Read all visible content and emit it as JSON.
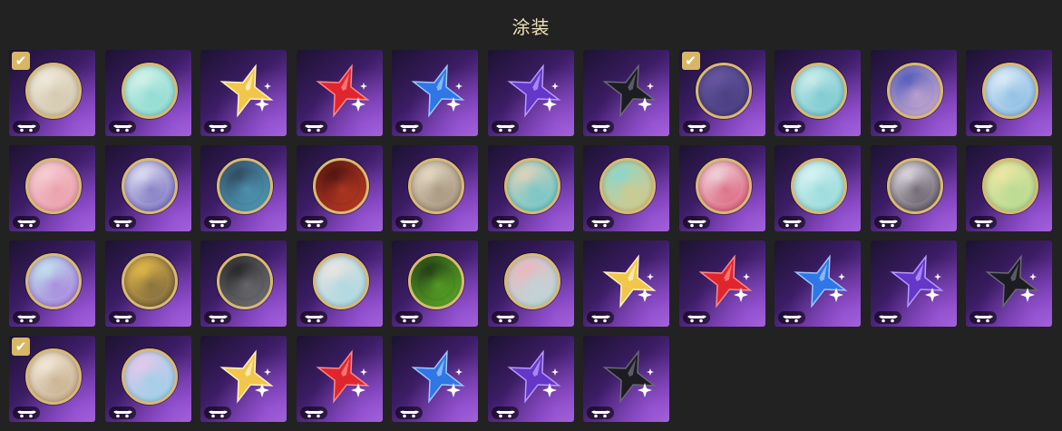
{
  "page": {
    "title": "涂装"
  },
  "tiles": [
    {
      "kind": "disc",
      "colors": [
        "#f4efe2",
        "#c7b89a"
      ],
      "selected": true,
      "icon": "white-creature-icon"
    },
    {
      "kind": "disc",
      "colors": [
        "#dff6ee",
        "#6fd0c6"
      ],
      "selected": false,
      "icon": "teal-wave-icon"
    },
    {
      "kind": "star",
      "colors": [
        "#f2c64a",
        "#fff3c4"
      ],
      "selected": false,
      "icon": "gold-star-icon"
    },
    {
      "kind": "star",
      "colors": [
        "#e0262c",
        "#ff8a8a"
      ],
      "selected": false,
      "icon": "red-star-icon"
    },
    {
      "kind": "star",
      "colors": [
        "#2f76e6",
        "#9cc7ff"
      ],
      "selected": false,
      "icon": "blue-star-icon"
    },
    {
      "kind": "star",
      "colors": [
        "#6437c8",
        "#b79bff"
      ],
      "selected": false,
      "icon": "purple-star-icon"
    },
    {
      "kind": "star",
      "colors": [
        "#1c1c22",
        "#6a6a78"
      ],
      "selected": false,
      "icon": "black-star-icon"
    },
    {
      "kind": "disc",
      "colors": [
        "#6a5aa6",
        "#3f3572"
      ],
      "selected": true,
      "icon": "emblem-icon"
    },
    {
      "kind": "disc",
      "colors": [
        "#d9f3f1",
        "#56b9c3"
      ],
      "selected": false,
      "icon": "cyan-beast-icon"
    },
    {
      "kind": "disc",
      "colors": [
        "#3f4fb8",
        "#f3c7d6"
      ],
      "selected": false,
      "icon": "pink-girl-icon"
    },
    {
      "kind": "disc",
      "colors": [
        "#e8f3fb",
        "#6ea9d9"
      ],
      "selected": false,
      "icon": "wave-pattern-icon"
    },
    {
      "kind": "disc",
      "colors": [
        "#f7d5da",
        "#e58b99"
      ],
      "selected": false,
      "icon": "pink-character-icon"
    },
    {
      "kind": "disc",
      "colors": [
        "#eef0fa",
        "#5b4fb0"
      ],
      "selected": false,
      "icon": "winged-crest-icon"
    },
    {
      "kind": "disc",
      "colors": [
        "#2a3d52",
        "#5db8d9"
      ],
      "selected": false,
      "icon": "blue-tree-icon"
    },
    {
      "kind": "disc",
      "colors": [
        "#3b0e0e",
        "#e4472a"
      ],
      "selected": false,
      "icon": "flame-icon"
    },
    {
      "kind": "disc",
      "colors": [
        "#efe4cf",
        "#8a7760"
      ],
      "selected": false,
      "icon": "moon-icon"
    },
    {
      "kind": "disc",
      "colors": [
        "#f4d5b4",
        "#3fc1d0"
      ],
      "selected": false,
      "icon": "orange-mask-icon"
    },
    {
      "kind": "disc",
      "colors": [
        "#7fd8d7",
        "#f1c56f"
      ],
      "selected": false,
      "icon": "blonde-character-icon"
    },
    {
      "kind": "disc",
      "colors": [
        "#f2e8ec",
        "#d43b5c"
      ],
      "selected": false,
      "icon": "dragon-swoosh-icon"
    },
    {
      "kind": "disc",
      "colors": [
        "#e3f7f6",
        "#7dcfd0"
      ],
      "selected": false,
      "icon": "crystal-spirit-icon"
    },
    {
      "kind": "disc",
      "colors": [
        "#f0eef2",
        "#3a2e3c"
      ],
      "selected": false,
      "icon": "eye-orb-icon"
    },
    {
      "kind": "disc",
      "colors": [
        "#f6e9a6",
        "#9fd48a"
      ],
      "selected": false,
      "icon": "green-girl-icon"
    },
    {
      "kind": "disc",
      "colors": [
        "#c6f1ee",
        "#9a62d6"
      ],
      "selected": false,
      "icon": "gem-eye-icon"
    },
    {
      "kind": "disc",
      "colors": [
        "#f2c64a",
        "#5a4a3a"
      ],
      "selected": false,
      "icon": "robot-pet-icon"
    },
    {
      "kind": "disc",
      "colors": [
        "#1b1b1d",
        "#8a8a8f"
      ],
      "selected": false,
      "icon": "dark-knight-icon"
    },
    {
      "kind": "disc",
      "colors": [
        "#f7e7e1",
        "#8ed1e0"
      ],
      "selected": false,
      "icon": "ice-figure-icon"
    },
    {
      "kind": "disc",
      "colors": [
        "#1a2a12",
        "#6ccf2d"
      ],
      "selected": false,
      "icon": "green-monster-icon"
    },
    {
      "kind": "disc",
      "colors": [
        "#f2b2b8",
        "#a9e3e6"
      ],
      "selected": false,
      "icon": "horned-ice-icon"
    },
    {
      "kind": "star",
      "colors": [
        "#f2c64a",
        "#fff3c4"
      ],
      "selected": false,
      "icon": "gold-star-icon"
    },
    {
      "kind": "star",
      "colors": [
        "#e0262c",
        "#ff8a8a"
      ],
      "selected": false,
      "icon": "red-star-icon"
    },
    {
      "kind": "star",
      "colors": [
        "#2f76e6",
        "#9cc7ff"
      ],
      "selected": false,
      "icon": "blue-star-icon"
    },
    {
      "kind": "star",
      "colors": [
        "#6437c8",
        "#b79bff"
      ],
      "selected": false,
      "icon": "purple-star-icon"
    },
    {
      "kind": "star",
      "colors": [
        "#1c1c22",
        "#6a6a78"
      ],
      "selected": false,
      "icon": "black-star-icon"
    },
    {
      "kind": "disc",
      "colors": [
        "#f8f2e6",
        "#b89870"
      ],
      "selected": true,
      "icon": "white-creature-icon"
    },
    {
      "kind": "disc",
      "colors": [
        "#f3c6ec",
        "#7ed3e6"
      ],
      "selected": false,
      "icon": "pink-cat-icon"
    },
    {
      "kind": "star",
      "colors": [
        "#f2c64a",
        "#fff3c4"
      ],
      "selected": false,
      "icon": "gold-star-icon"
    },
    {
      "kind": "star",
      "colors": [
        "#e0262c",
        "#ff8a8a"
      ],
      "selected": false,
      "icon": "red-star-icon"
    },
    {
      "kind": "star",
      "colors": [
        "#2f76e6",
        "#9cc7ff"
      ],
      "selected": false,
      "icon": "blue-star-icon"
    },
    {
      "kind": "star",
      "colors": [
        "#6437c8",
        "#b79bff"
      ],
      "selected": false,
      "icon": "purple-star-icon"
    },
    {
      "kind": "star",
      "colors": [
        "#1c1c22",
        "#6a6a78"
      ],
      "selected": false,
      "icon": "black-star-icon"
    }
  ]
}
